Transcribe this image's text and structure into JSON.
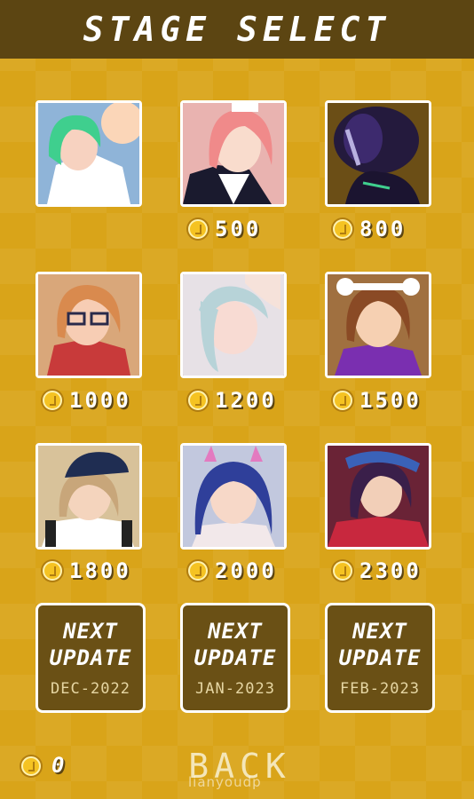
{
  "header": {
    "title": "STAGE SELECT"
  },
  "stages": [
    {
      "name": "stage-1",
      "price": "",
      "bg": "#8fb4d8",
      "hair": "#3fcf8e",
      "skin": "#f7d2c0"
    },
    {
      "name": "stage-2",
      "price": "500",
      "bg": "#e9b3b0",
      "hair": "#f08a8a",
      "skin": "#f9dccd"
    },
    {
      "name": "stage-3",
      "price": "800",
      "bg": "#241a3d",
      "hair": "#3d2a6e",
      "skin": "#5b4a9a"
    },
    {
      "name": "stage-4",
      "price": "1000",
      "bg": "#d9a77a",
      "hair": "#d98a4e",
      "skin": "#f7cdb4"
    },
    {
      "name": "stage-5",
      "price": "1200",
      "bg": "#e7e1e6",
      "hair": "#b7d3d8",
      "skin": "#f8dbd3"
    },
    {
      "name": "stage-6",
      "price": "1500",
      "bg": "#a07040",
      "hair": "#8a4a25",
      "skin": "#f6d0b2"
    },
    {
      "name": "stage-7",
      "price": "1800",
      "bg": "#d8c29a",
      "hair": "#c8a67a",
      "skin": "#f4d4bd"
    },
    {
      "name": "stage-8",
      "price": "2000",
      "bg": "#c2c8de",
      "hair": "#2f3f9a",
      "skin": "#f7d8c8"
    },
    {
      "name": "stage-9",
      "price": "2300",
      "bg": "#6a2336",
      "hair": "#3a1f4a",
      "skin": "#f2cfb8"
    }
  ],
  "next_updates": [
    {
      "line1": "NEXT",
      "line2": "UPDATE",
      "date": "DEC-2022"
    },
    {
      "line1": "NEXT",
      "line2": "UPDATE",
      "date": "JAN-2023"
    },
    {
      "line1": "NEXT",
      "line2": "UPDATE",
      "date": "FEB-2023"
    }
  ],
  "footer": {
    "coins": "0",
    "back_label": "BACK",
    "watermark": "lianyoudp"
  },
  "colors": {
    "background": "#d9a419",
    "header": "#5c4512",
    "panel": "#6a5015",
    "coin": "#f5c322"
  },
  "icons": {
    "currency": "coin-icon"
  }
}
